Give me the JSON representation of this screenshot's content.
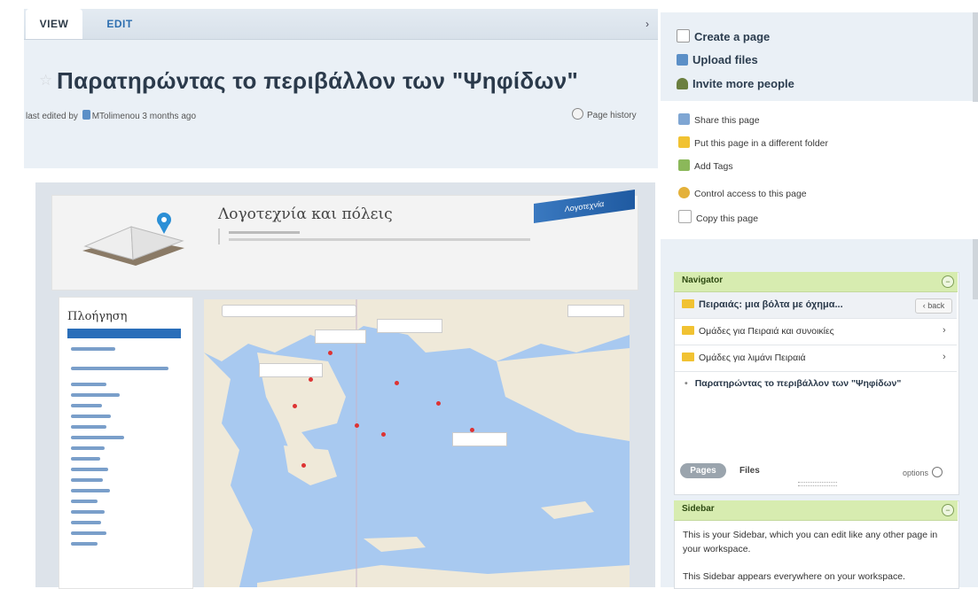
{
  "tabs": {
    "view": "VIEW",
    "edit": "EDIT"
  },
  "page": {
    "title": "Παρατηρώντας το περιβάλλον των \"Ψηφίδων\"",
    "edited_prefix": "last edited by",
    "edited_user": "MTolimenou",
    "edited_suffix": "3 months ago",
    "history": "Page history"
  },
  "actions": {
    "create": "Create a page",
    "upload": "Upload files",
    "invite": "Invite more people",
    "share": "Share this page",
    "move": "Put this page in a different folder",
    "tags": "Add Tags",
    "access": "Control access to this page",
    "copy": "Copy this page"
  },
  "embedded": {
    "site_title": "Λογοτεχνία και πόλεις",
    "banner": "Λογοτεχνία",
    "nav_title": "Πλοήγηση"
  },
  "navigator": {
    "header": "Navigator",
    "back": "back",
    "rows": [
      "Πειραιάς: μια βόλτα με όχημα...",
      "Ομάδες για Πειραιά και συνοικίες",
      "Ομάδες για λιμάνι Πειραιά",
      "Παρατηρώντας το περιβάλλον των \"Ψηφίδων\""
    ],
    "pages_tab": "Pages",
    "files_tab": "Files",
    "options": "options"
  },
  "sidebar": {
    "header": "Sidebar",
    "p1": "This is your Sidebar, which you can edit like any other page in your workspace.",
    "p2": "This Sidebar appears everywhere on your workspace."
  },
  "colors": {
    "accent": "#2e6fb0",
    "nav_header": "#d7ecb0",
    "bg": "#eaf0f6"
  }
}
